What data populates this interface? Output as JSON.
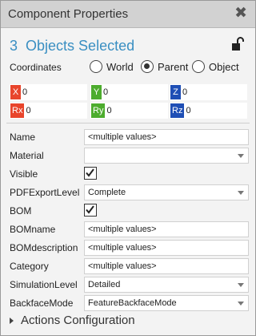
{
  "window": {
    "title": "Component Properties",
    "close_icon": "close-icon"
  },
  "heading": {
    "count": "3",
    "text": "Objects Selected"
  },
  "lock_icon": "unlock-icon",
  "coordinates": {
    "label": "Coordinates",
    "options": [
      "World",
      "Parent",
      "Object"
    ],
    "selected": "Parent"
  },
  "vectors": {
    "x": {
      "tag": "X",
      "value": "0"
    },
    "y": {
      "tag": "Y",
      "value": "0"
    },
    "z": {
      "tag": "Z",
      "value": "0"
    },
    "rx": {
      "tag": "Rx",
      "value": "0"
    },
    "ry": {
      "tag": "Ry",
      "value": "0"
    },
    "rz": {
      "tag": "Rz",
      "value": "0"
    }
  },
  "colors": {
    "red": "#e8452c",
    "green": "#4dac2e",
    "blue": "#1f4fb5",
    "accent": "#3a8fc2"
  },
  "properties": {
    "name": {
      "label": "Name",
      "value": "<multiple values>"
    },
    "material": {
      "label": "Material",
      "value": ""
    },
    "visible": {
      "label": "Visible",
      "checked": true
    },
    "pdf_export_level": {
      "label": "PDFExportLevel",
      "value": "Complete"
    },
    "bom": {
      "label": "BOM",
      "checked": true
    },
    "bom_name": {
      "label": "BOMname",
      "value": "<multiple values>"
    },
    "bom_description": {
      "label": "BOMdescription",
      "value": "<multiple values>"
    },
    "category": {
      "label": "Category",
      "value": "<multiple values>"
    },
    "simulation_level": {
      "label": "SimulationLevel",
      "value": "Detailed"
    },
    "backface_mode": {
      "label": "BackfaceMode",
      "value": "FeatureBackfaceMode"
    }
  },
  "actions": {
    "label": "Actions Configuration"
  }
}
